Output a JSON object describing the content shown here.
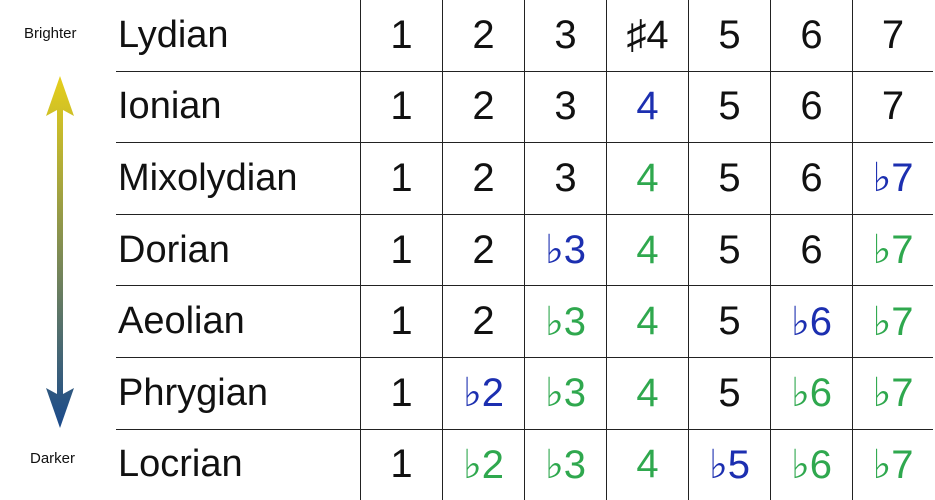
{
  "labels": {
    "brighter": "Brighter",
    "darker": "Darker"
  },
  "colors": {
    "changed": "#1c2fb0",
    "inherited": "#2fa84e",
    "natural": "#111111",
    "arrow_top": "#e6cf1a",
    "arrow_bottom": "#1a4a8c"
  },
  "modes": [
    {
      "name": "Lydian",
      "degrees": [
        {
          "t": "1",
          "c": "black"
        },
        {
          "t": "2",
          "c": "black"
        },
        {
          "t": "3",
          "c": "black"
        },
        {
          "t": "♯4",
          "c": "black"
        },
        {
          "t": "5",
          "c": "black"
        },
        {
          "t": "6",
          "c": "black"
        },
        {
          "t": "7",
          "c": "black"
        }
      ]
    },
    {
      "name": "Ionian",
      "degrees": [
        {
          "t": "1",
          "c": "black"
        },
        {
          "t": "2",
          "c": "black"
        },
        {
          "t": "3",
          "c": "black"
        },
        {
          "t": "4",
          "c": "blue"
        },
        {
          "t": "5",
          "c": "black"
        },
        {
          "t": "6",
          "c": "black"
        },
        {
          "t": "7",
          "c": "black"
        }
      ]
    },
    {
      "name": "Mixolydian",
      "degrees": [
        {
          "t": "1",
          "c": "black"
        },
        {
          "t": "2",
          "c": "black"
        },
        {
          "t": "3",
          "c": "black"
        },
        {
          "t": "4",
          "c": "green"
        },
        {
          "t": "5",
          "c": "black"
        },
        {
          "t": "6",
          "c": "black"
        },
        {
          "t": "♭7",
          "c": "blue"
        }
      ]
    },
    {
      "name": "Dorian",
      "degrees": [
        {
          "t": "1",
          "c": "black"
        },
        {
          "t": "2",
          "c": "black"
        },
        {
          "t": "♭3",
          "c": "blue"
        },
        {
          "t": "4",
          "c": "green"
        },
        {
          "t": "5",
          "c": "black"
        },
        {
          "t": "6",
          "c": "black"
        },
        {
          "t": "♭7",
          "c": "green"
        }
      ]
    },
    {
      "name": "Aeolian",
      "degrees": [
        {
          "t": "1",
          "c": "black"
        },
        {
          "t": "2",
          "c": "black"
        },
        {
          "t": "♭3",
          "c": "green"
        },
        {
          "t": "4",
          "c": "green"
        },
        {
          "t": "5",
          "c": "black"
        },
        {
          "t": "♭6",
          "c": "blue"
        },
        {
          "t": "♭7",
          "c": "green"
        }
      ]
    },
    {
      "name": "Phrygian",
      "degrees": [
        {
          "t": "1",
          "c": "black"
        },
        {
          "t": "♭2",
          "c": "blue"
        },
        {
          "t": "♭3",
          "c": "green"
        },
        {
          "t": "4",
          "c": "green"
        },
        {
          "t": "5",
          "c": "black"
        },
        {
          "t": "♭6",
          "c": "green"
        },
        {
          "t": "♭7",
          "c": "green"
        }
      ]
    },
    {
      "name": "Locrian",
      "degrees": [
        {
          "t": "1",
          "c": "black"
        },
        {
          "t": "♭2",
          "c": "green"
        },
        {
          "t": "♭3",
          "c": "green"
        },
        {
          "t": "4",
          "c": "green"
        },
        {
          "t": "♭5",
          "c": "blue"
        },
        {
          "t": "♭6",
          "c": "green"
        },
        {
          "t": "♭7",
          "c": "green"
        }
      ]
    }
  ]
}
